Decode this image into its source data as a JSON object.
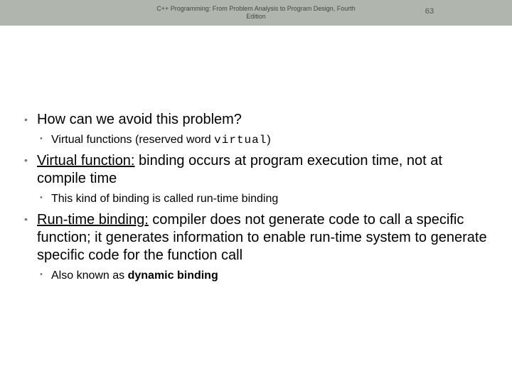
{
  "header": {
    "title_line1": "C++ Programming: From Problem Analysis to Program Design, Fourth",
    "title_line2": "Edition",
    "page_number": "63"
  },
  "bullets": {
    "b1": "How can we avoid this problem?",
    "b1_sub_pre": "Virtual functions (reserved word ",
    "b1_sub_code": "virtual",
    "b1_sub_post": ")",
    "b2_term": "Virtual function:",
    "b2_rest": " binding occurs at program execution time, not at compile time",
    "b2_sub": "This kind of binding is called run-time binding",
    "b3_term": "Run-time binding:",
    "b3_rest": " compiler does not generate code to call a specific function; it generates information to enable run-time system to generate specific code for the function call",
    "b3_sub_pre": "Also known as ",
    "b3_sub_bold": "dynamic binding"
  }
}
